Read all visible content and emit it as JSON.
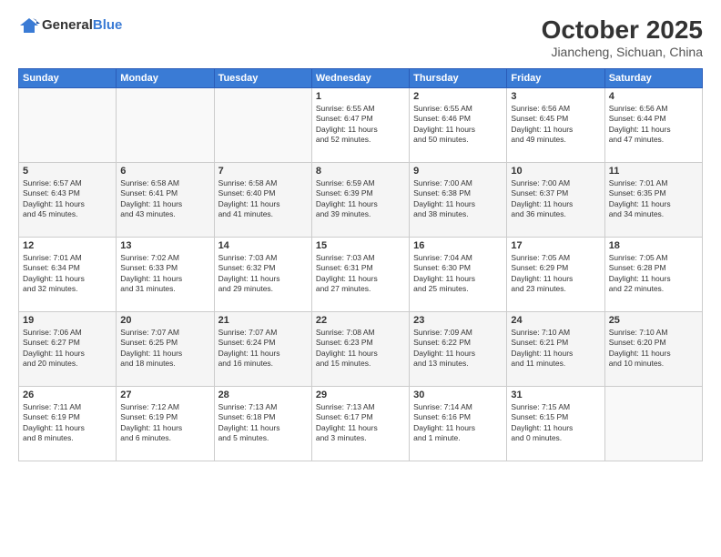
{
  "header": {
    "logo_general": "General",
    "logo_blue": "Blue",
    "month": "October 2025",
    "location": "Jiancheng, Sichuan, China"
  },
  "weekdays": [
    "Sunday",
    "Monday",
    "Tuesday",
    "Wednesday",
    "Thursday",
    "Friday",
    "Saturday"
  ],
  "weeks": [
    [
      {
        "day": "",
        "info": ""
      },
      {
        "day": "",
        "info": ""
      },
      {
        "day": "",
        "info": ""
      },
      {
        "day": "1",
        "info": "Sunrise: 6:55 AM\nSunset: 6:47 PM\nDaylight: 11 hours\nand 52 minutes."
      },
      {
        "day": "2",
        "info": "Sunrise: 6:55 AM\nSunset: 6:46 PM\nDaylight: 11 hours\nand 50 minutes."
      },
      {
        "day": "3",
        "info": "Sunrise: 6:56 AM\nSunset: 6:45 PM\nDaylight: 11 hours\nand 49 minutes."
      },
      {
        "day": "4",
        "info": "Sunrise: 6:56 AM\nSunset: 6:44 PM\nDaylight: 11 hours\nand 47 minutes."
      }
    ],
    [
      {
        "day": "5",
        "info": "Sunrise: 6:57 AM\nSunset: 6:43 PM\nDaylight: 11 hours\nand 45 minutes."
      },
      {
        "day": "6",
        "info": "Sunrise: 6:58 AM\nSunset: 6:41 PM\nDaylight: 11 hours\nand 43 minutes."
      },
      {
        "day": "7",
        "info": "Sunrise: 6:58 AM\nSunset: 6:40 PM\nDaylight: 11 hours\nand 41 minutes."
      },
      {
        "day": "8",
        "info": "Sunrise: 6:59 AM\nSunset: 6:39 PM\nDaylight: 11 hours\nand 39 minutes."
      },
      {
        "day": "9",
        "info": "Sunrise: 7:00 AM\nSunset: 6:38 PM\nDaylight: 11 hours\nand 38 minutes."
      },
      {
        "day": "10",
        "info": "Sunrise: 7:00 AM\nSunset: 6:37 PM\nDaylight: 11 hours\nand 36 minutes."
      },
      {
        "day": "11",
        "info": "Sunrise: 7:01 AM\nSunset: 6:35 PM\nDaylight: 11 hours\nand 34 minutes."
      }
    ],
    [
      {
        "day": "12",
        "info": "Sunrise: 7:01 AM\nSunset: 6:34 PM\nDaylight: 11 hours\nand 32 minutes."
      },
      {
        "day": "13",
        "info": "Sunrise: 7:02 AM\nSunset: 6:33 PM\nDaylight: 11 hours\nand 31 minutes."
      },
      {
        "day": "14",
        "info": "Sunrise: 7:03 AM\nSunset: 6:32 PM\nDaylight: 11 hours\nand 29 minutes."
      },
      {
        "day": "15",
        "info": "Sunrise: 7:03 AM\nSunset: 6:31 PM\nDaylight: 11 hours\nand 27 minutes."
      },
      {
        "day": "16",
        "info": "Sunrise: 7:04 AM\nSunset: 6:30 PM\nDaylight: 11 hours\nand 25 minutes."
      },
      {
        "day": "17",
        "info": "Sunrise: 7:05 AM\nSunset: 6:29 PM\nDaylight: 11 hours\nand 23 minutes."
      },
      {
        "day": "18",
        "info": "Sunrise: 7:05 AM\nSunset: 6:28 PM\nDaylight: 11 hours\nand 22 minutes."
      }
    ],
    [
      {
        "day": "19",
        "info": "Sunrise: 7:06 AM\nSunset: 6:27 PM\nDaylight: 11 hours\nand 20 minutes."
      },
      {
        "day": "20",
        "info": "Sunrise: 7:07 AM\nSunset: 6:25 PM\nDaylight: 11 hours\nand 18 minutes."
      },
      {
        "day": "21",
        "info": "Sunrise: 7:07 AM\nSunset: 6:24 PM\nDaylight: 11 hours\nand 16 minutes."
      },
      {
        "day": "22",
        "info": "Sunrise: 7:08 AM\nSunset: 6:23 PM\nDaylight: 11 hours\nand 15 minutes."
      },
      {
        "day": "23",
        "info": "Sunrise: 7:09 AM\nSunset: 6:22 PM\nDaylight: 11 hours\nand 13 minutes."
      },
      {
        "day": "24",
        "info": "Sunrise: 7:10 AM\nSunset: 6:21 PM\nDaylight: 11 hours\nand 11 minutes."
      },
      {
        "day": "25",
        "info": "Sunrise: 7:10 AM\nSunset: 6:20 PM\nDaylight: 11 hours\nand 10 minutes."
      }
    ],
    [
      {
        "day": "26",
        "info": "Sunrise: 7:11 AM\nSunset: 6:19 PM\nDaylight: 11 hours\nand 8 minutes."
      },
      {
        "day": "27",
        "info": "Sunrise: 7:12 AM\nSunset: 6:19 PM\nDaylight: 11 hours\nand 6 minutes."
      },
      {
        "day": "28",
        "info": "Sunrise: 7:13 AM\nSunset: 6:18 PM\nDaylight: 11 hours\nand 5 minutes."
      },
      {
        "day": "29",
        "info": "Sunrise: 7:13 AM\nSunset: 6:17 PM\nDaylight: 11 hours\nand 3 minutes."
      },
      {
        "day": "30",
        "info": "Sunrise: 7:14 AM\nSunset: 6:16 PM\nDaylight: 11 hours\nand 1 minute."
      },
      {
        "day": "31",
        "info": "Sunrise: 7:15 AM\nSunset: 6:15 PM\nDaylight: 11 hours\nand 0 minutes."
      },
      {
        "day": "",
        "info": ""
      }
    ]
  ]
}
